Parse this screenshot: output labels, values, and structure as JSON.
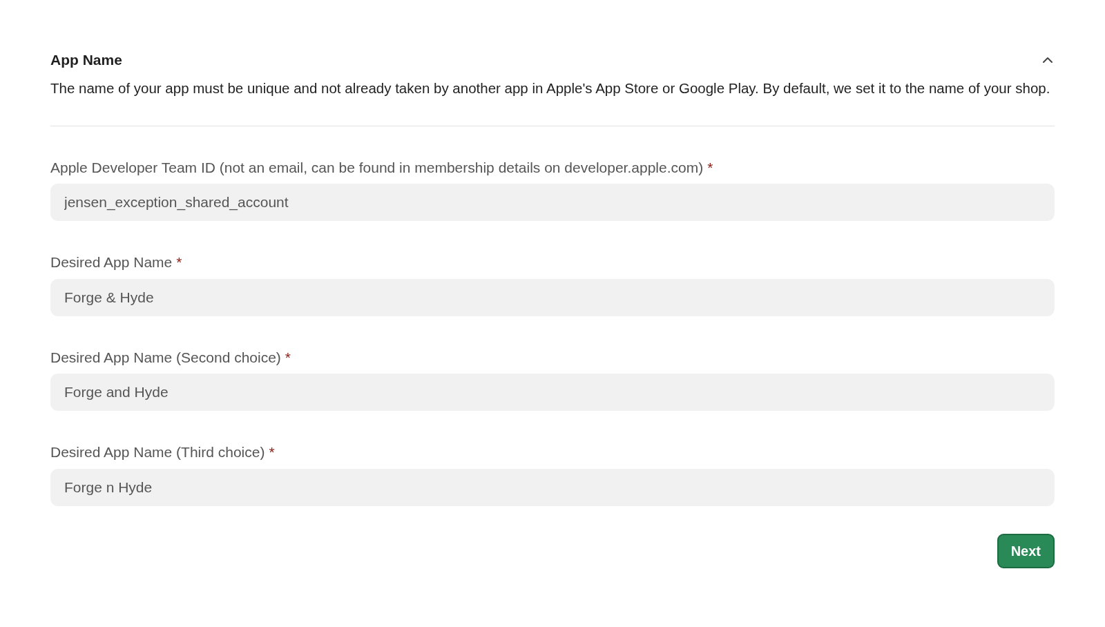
{
  "section": {
    "title": "App Name",
    "expanded": true,
    "description": "The name of your app must be unique and not already taken by another app in Apple's App Store or Google Play. By default, we set it to the name of your shop."
  },
  "fields": [
    {
      "label": "Apple Developer Team ID (not an email, can be found in membership details on developer.apple.com)",
      "required_mark": "*",
      "value": "jensen_exception_shared_account"
    },
    {
      "label": "Desired App Name",
      "required_mark": "*",
      "value": "Forge & Hyde"
    },
    {
      "label": "Desired App Name (Second choice)",
      "required_mark": "*",
      "value": "Forge and Hyde"
    },
    {
      "label": "Desired App Name (Third choice)",
      "required_mark": "*",
      "value": "Forge n Hyde"
    }
  ],
  "next_button": {
    "label": "Next"
  }
}
